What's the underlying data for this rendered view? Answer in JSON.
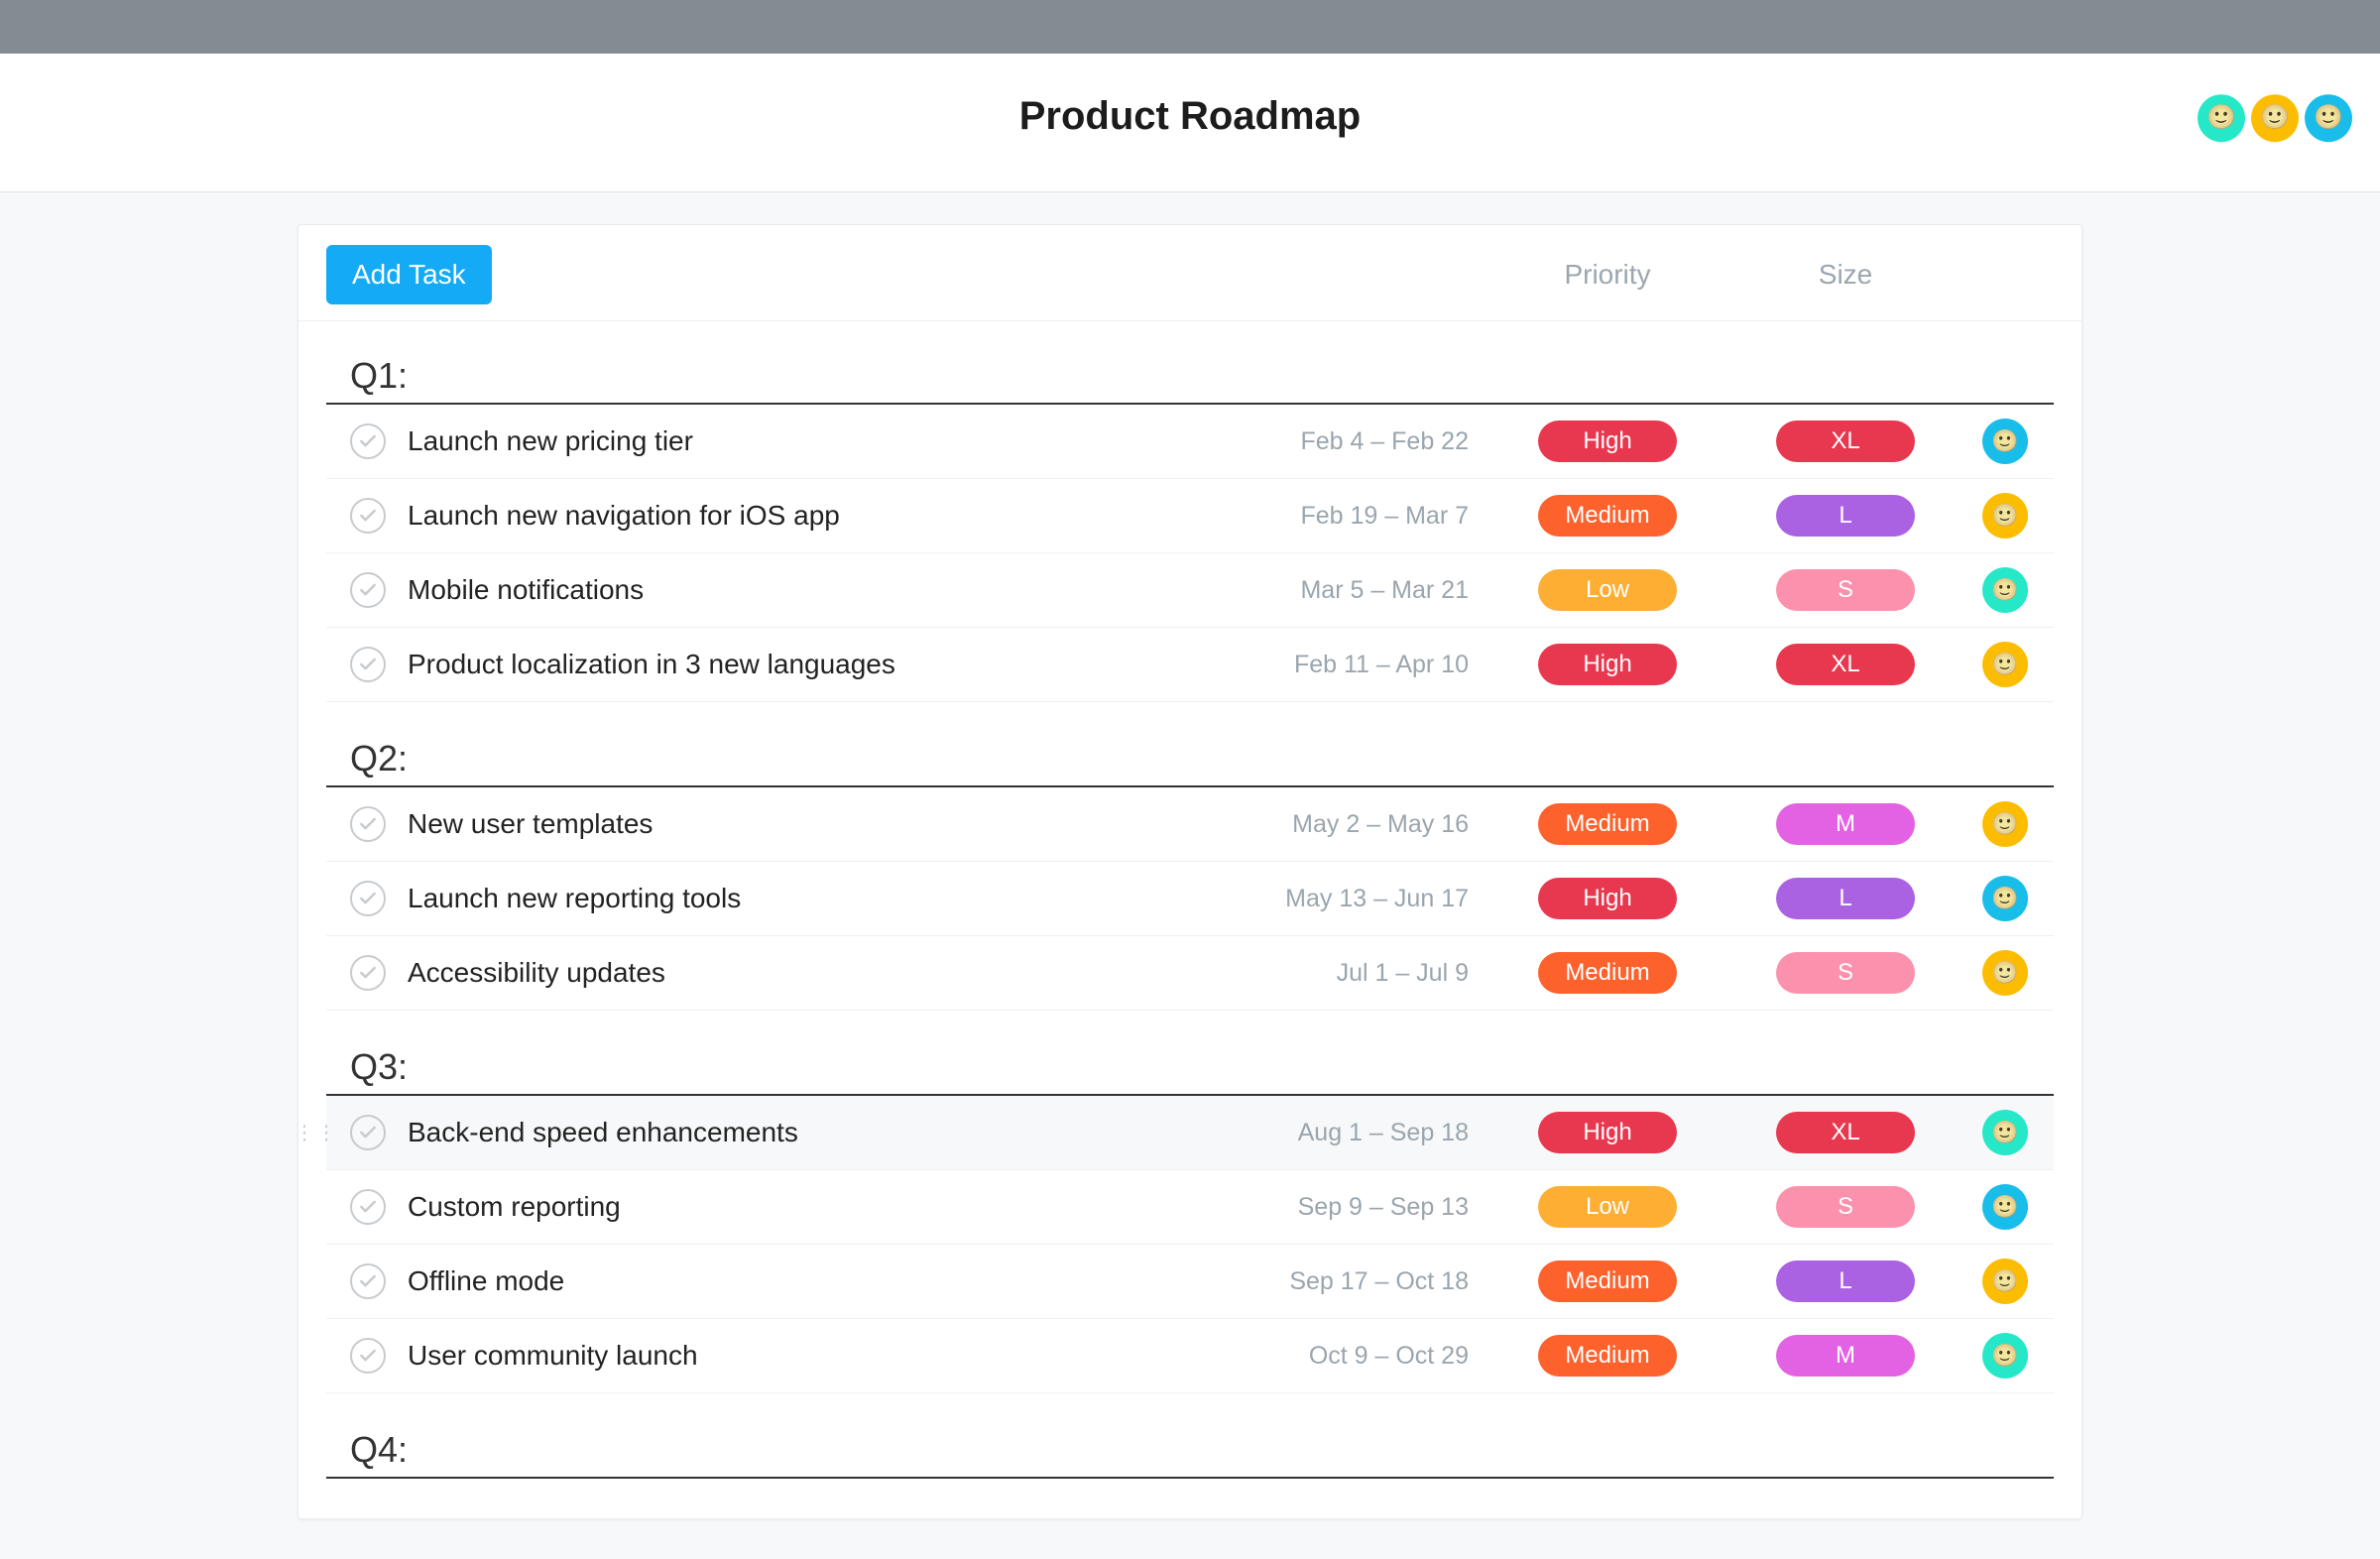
{
  "page": {
    "title": "Product Roadmap"
  },
  "toolbar": {
    "add_task_label": "Add Task",
    "column_priority": "Priority",
    "column_size": "Size"
  },
  "header_avatars": [
    "green",
    "yellow",
    "blue"
  ],
  "colors": {
    "priority": {
      "High": "#e8384f",
      "Medium": "#fd612c",
      "Low": "#fdae33"
    },
    "size": {
      "XL": "#e8384f",
      "L": "#aa62e3",
      "M": "#e362e3",
      "S": "#fc91ad"
    },
    "avatar": {
      "green": "#25e8c8",
      "yellow": "#fcbd01",
      "blue": "#19bdea"
    }
  },
  "sections": [
    {
      "heading": "Q1:",
      "tasks": [
        {
          "name": "Launch new pricing tier",
          "dates": "Feb 4 – Feb 22",
          "priority": "High",
          "size": "XL",
          "assignee": "blue"
        },
        {
          "name": "Launch new navigation for iOS app",
          "dates": "Feb 19 – Mar 7",
          "priority": "Medium",
          "size": "L",
          "assignee": "yellow"
        },
        {
          "name": "Mobile notifications",
          "dates": "Mar 5 – Mar 21",
          "priority": "Low",
          "size": "S",
          "assignee": "green"
        },
        {
          "name": "Product localization in 3 new languages",
          "dates": "Feb 11 – Apr 10",
          "priority": "High",
          "size": "XL",
          "assignee": "yellow"
        }
      ]
    },
    {
      "heading": "Q2:",
      "tasks": [
        {
          "name": "New user templates",
          "dates": "May 2 – May 16",
          "priority": "Medium",
          "size": "M",
          "assignee": "yellow"
        },
        {
          "name": "Launch new reporting tools",
          "dates": "May 13 – Jun 17",
          "priority": "High",
          "size": "L",
          "assignee": "blue"
        },
        {
          "name": "Accessibility updates",
          "dates": "Jul 1 – Jul 9",
          "priority": "Medium",
          "size": "S",
          "assignee": "yellow"
        }
      ]
    },
    {
      "heading": "Q3:",
      "tasks": [
        {
          "name": "Back-end speed enhancements",
          "dates": "Aug 1 – Sep 18",
          "priority": "High",
          "size": "XL",
          "assignee": "green",
          "hovered": true
        },
        {
          "name": "Custom reporting",
          "dates": "Sep 9 – Sep 13",
          "priority": "Low",
          "size": "S",
          "assignee": "blue"
        },
        {
          "name": "Offline mode",
          "dates": "Sep 17 – Oct 18",
          "priority": "Medium",
          "size": "L",
          "assignee": "yellow"
        },
        {
          "name": "User community launch",
          "dates": "Oct 9 – Oct 29",
          "priority": "Medium",
          "size": "M",
          "assignee": "green"
        }
      ]
    },
    {
      "heading": "Q4:",
      "tasks": []
    }
  ]
}
